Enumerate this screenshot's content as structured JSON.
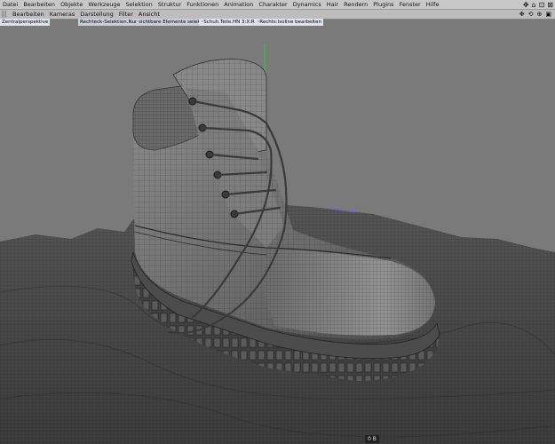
{
  "menu": [
    "Datei",
    "Bearbeiten",
    "Objekte",
    "Werkzeuge",
    "Selektion",
    "Struktur",
    "Funktionen",
    "Animation",
    "Charakter",
    "Dynamics",
    "Hair",
    "Rendern",
    "Plugins",
    "Fenster",
    "Hilfe"
  ],
  "window_controls": {
    "move": "✥",
    "home": "⌂",
    "restore": "⊡",
    "close": "⊠"
  },
  "toolbar": [
    "Bearbeiten",
    "Kameras",
    "Darstellung",
    "Filter",
    "Ansicht"
  ],
  "toolbar_icons": {
    "move": "✥",
    "rotate": "⟲",
    "zoom": "⊕",
    "maximize": "▣"
  },
  "info": {
    "view_name": "Zentralperspektive",
    "tool_hint": "Rechteck-Selektion.Nur sichtbare Elemente selektieren",
    "object_info": "◦Schuh.Teile.HN 3:X:Ray",
    "tool_hint2": "◦Rechts:Isoline bearbeiten"
  },
  "status": {
    "frame": "0 B"
  },
  "colors": {
    "viewport_bg": "#7a7a7a",
    "menu_bg": "#c8c8c8",
    "badge_bg": "#dfe3ee"
  }
}
